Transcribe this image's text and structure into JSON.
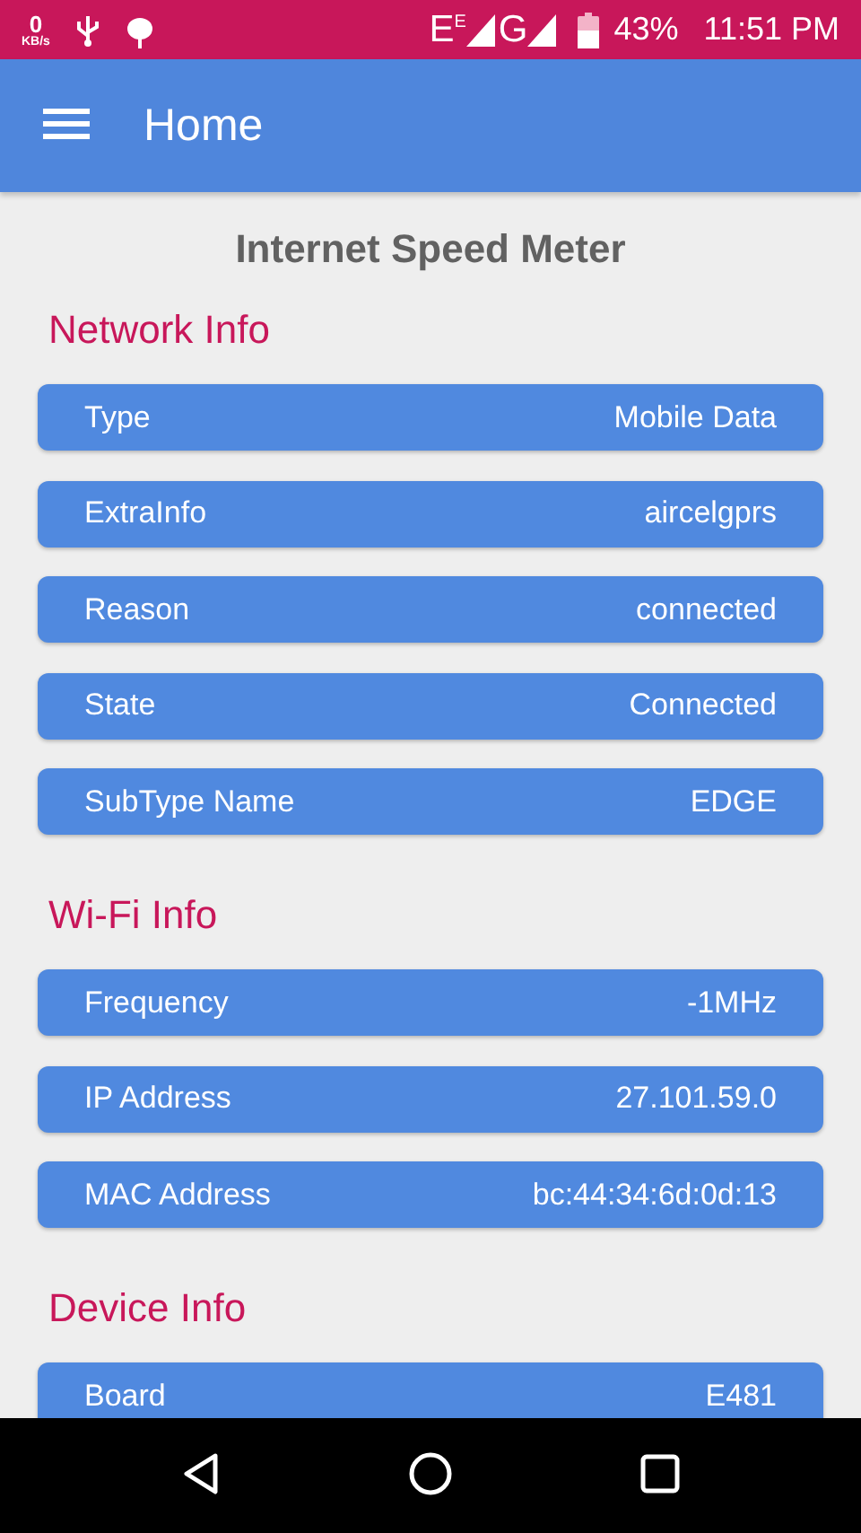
{
  "status_bar": {
    "speed_value": "0",
    "speed_unit": "KB/s",
    "network_type": "E$^{E}$",
    "network_type_2": "G",
    "battery": "43%",
    "time": "11:51 PM"
  },
  "app_bar": {
    "title": "Home"
  },
  "page_title": "Internet Speed Meter",
  "sections": [
    {
      "title": "Network Info",
      "rows": [
        {
          "label": "Type",
          "value": "Mobile Data"
        },
        {
          "label": "ExtraInfo",
          "value": "aircelgprs"
        },
        {
          "label": "Reason",
          "value": "connected"
        },
        {
          "label": "State",
          "value": "Connected"
        },
        {
          "label": "SubType Name",
          "value": "EDGE"
        }
      ]
    },
    {
      "title": "Wi-Fi Info",
      "rows": [
        {
          "label": "Frequency",
          "value": "-1MHz"
        },
        {
          "label": "IP Address",
          "value": "27.101.59.0"
        },
        {
          "label": "MAC Address",
          "value": "bc:44:34:6d:0d:13"
        }
      ]
    },
    {
      "title": "Device Info",
      "rows": [
        {
          "label": "Board",
          "value": "E481"
        }
      ]
    }
  ]
}
